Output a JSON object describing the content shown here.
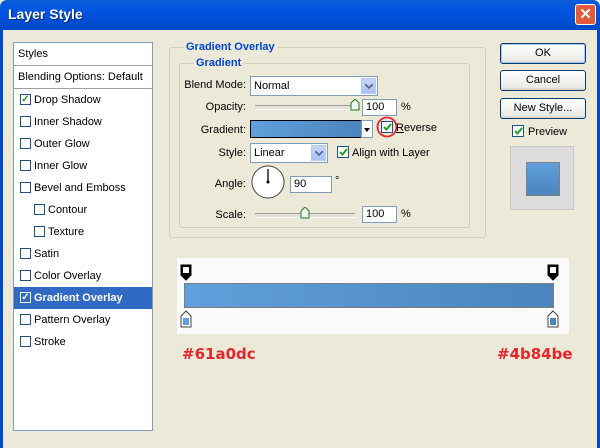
{
  "window": {
    "title": "Layer Style",
    "close_glyph": "✕",
    "titlebar_color": "#0053e0"
  },
  "styles_list": {
    "header": "Styles",
    "blending": "Blending Options: Default",
    "items": [
      {
        "label": "Drop Shadow",
        "checked": true
      },
      {
        "label": "Inner Shadow",
        "checked": false
      },
      {
        "label": "Outer Glow",
        "checked": false
      },
      {
        "label": "Inner Glow",
        "checked": false
      },
      {
        "label": "Bevel and Emboss",
        "checked": false
      },
      {
        "label": "Contour",
        "checked": false
      },
      {
        "label": "Texture",
        "checked": false
      },
      {
        "label": "Satin",
        "checked": false
      },
      {
        "label": "Color Overlay",
        "checked": false
      },
      {
        "label": "Gradient Overlay",
        "checked": true,
        "selected": true
      },
      {
        "label": "Pattern Overlay",
        "checked": false
      },
      {
        "label": "Stroke",
        "checked": false
      }
    ]
  },
  "panel": {
    "group_title": "Gradient Overlay",
    "sub_title": "Gradient",
    "blend_mode_label": "Blend Mode:",
    "blend_mode_value": "Normal",
    "opacity_label": "Opacity:",
    "opacity_value": "100",
    "opacity_level": 1.0,
    "pct": "%",
    "gradient_label": "Gradient:",
    "reverse_label": "Reverse",
    "reverse_checked": true,
    "style_label": "Style:",
    "style_value": "Linear",
    "align_label": "Align with Layer",
    "align_checked": true,
    "angle_label": "Angle:",
    "angle_value": "90",
    "degree": "°",
    "scale_label": "Scale:",
    "scale_value": "100",
    "scale_level": 0.5
  },
  "buttons": {
    "ok": "OK",
    "cancel": "Cancel",
    "new_style": "New Style...",
    "preview_label": "Preview",
    "preview_checked": true
  },
  "gradient_editor": {
    "start_color": "#61a0dc",
    "end_color": "#4b84be",
    "start_label": "#61a0dc",
    "end_label": "#4b84be"
  }
}
